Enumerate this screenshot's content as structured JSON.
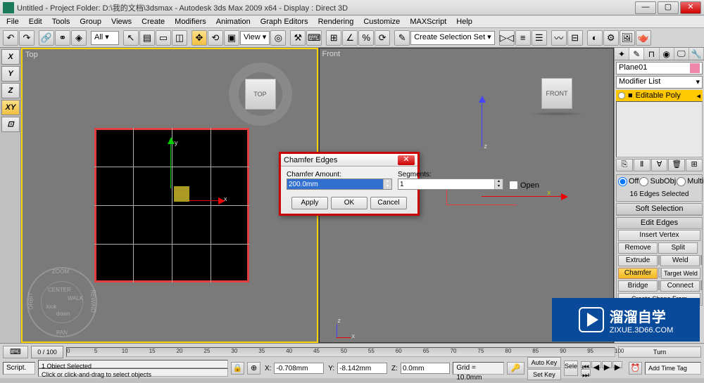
{
  "window": {
    "title": "Untitled    - Project Folder: D:\\我的文档\\3dsmax    - Autodesk 3ds Max  2009 x64       - Display : Direct 3D"
  },
  "menu": [
    "File",
    "Edit",
    "Tools",
    "Group",
    "Views",
    "Create",
    "Modifiers",
    "Animation",
    "Graph Editors",
    "Rendering",
    "Customize",
    "MAXScript",
    "Help"
  ],
  "toolbar": {
    "all": "All",
    "view": "View",
    "selset": "Create Selection Set"
  },
  "axisTabs": [
    "X",
    "Y",
    "Z",
    "XY"
  ],
  "viewportTop": {
    "label": "Top",
    "cube": "TOP"
  },
  "viewportFront": {
    "label": "Front",
    "cube": "FRONT"
  },
  "axisLabels": {
    "x": "x",
    "y": "y",
    "z": "z"
  },
  "navWheel": {
    "zoom": "ZOOM",
    "orbit": "ORBIT",
    "pan": "PAN",
    "rewind": "REWIND",
    "center": "CENTER",
    "walk": "WALK",
    "look": "look",
    "down": "down"
  },
  "dialog": {
    "title": "Chamfer Edges",
    "amountLabel": "Chamfer Amount:",
    "segmentsLabel": "Segments:",
    "amountValue": "200.0mm",
    "segmentsValue": "1",
    "openLabel": "Open",
    "apply": "Apply",
    "ok": "OK",
    "cancel": "Cancel"
  },
  "panel": {
    "objectName": "Plane01",
    "modifierList": "Modifier List",
    "editablePoly": "Editable Poly",
    "selection": {
      "off": "Off",
      "subobj": "SubObj",
      "multi": "Multi",
      "info": "16 Edges Selected"
    },
    "rollouts": {
      "softsel": "Soft Selection",
      "editedges": "Edit Edges",
      "insertvertex": "Insert Vertex",
      "remove": "Remove",
      "split": "Split",
      "extrude": "Extrude",
      "weld": "Weld",
      "chamfer": "Chamfer",
      "targetweld": "Target Weld",
      "bridge": "Bridge",
      "connect": "Connect",
      "createshape": "Create Shape From Selection",
      "turn": "Turn"
    }
  },
  "status": {
    "timepos": "0 / 100",
    "ticks": [
      "0",
      "5",
      "10",
      "15",
      "20",
      "25",
      "30",
      "35",
      "40",
      "45",
      "50",
      "55",
      "60",
      "65",
      "70",
      "75",
      "80",
      "85",
      "90",
      "95",
      "100"
    ],
    "selected": "1 Object Selected",
    "hint": "Click or click-and-drag to select objects",
    "script": "Script.",
    "x": "-0.708mm",
    "y": "-8.142mm",
    "z": "0.0mm",
    "grid": "Grid = 10.0mm",
    "autokey": "Auto Key",
    "setkey": "Set Key",
    "selec": "Sele",
    "addtag": "Add Time Tag"
  },
  "watermark": {
    "cn": "溜溜自学",
    "url": "ZIXUE.3D66.COM"
  }
}
